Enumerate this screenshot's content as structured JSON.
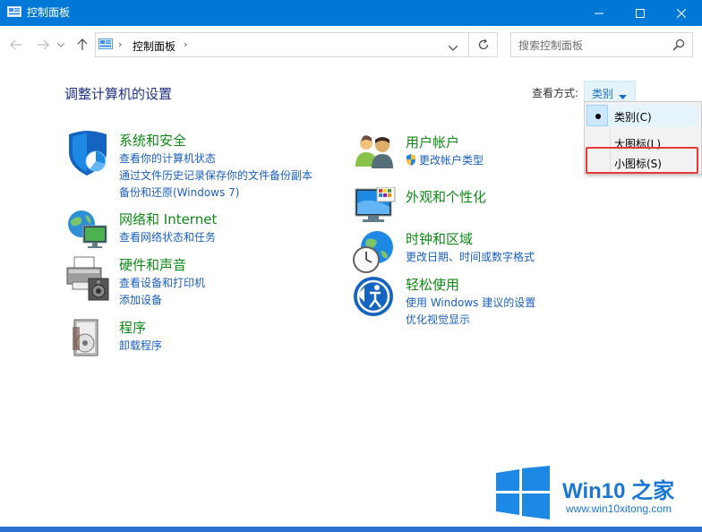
{
  "window": {
    "title": "控制面板"
  },
  "address": {
    "breadcrumb": "控制面板",
    "search_placeholder": "搜索控制面板"
  },
  "main": {
    "heading": "调整计算机的设置",
    "view_by_label": "查看方式:",
    "view_by_value": "类别"
  },
  "view_menu": {
    "items": [
      "类别(C)",
      "大图标(L)",
      "小图标(S)"
    ],
    "selected": "类别(C)",
    "highlighted": "小图标(S)"
  },
  "categories": {
    "left": [
      {
        "title": "系统和安全",
        "links": [
          "查看你的计算机状态",
          "通过文件历史记录保存你的文件备份副本",
          "备份和还原(Windows 7)"
        ]
      },
      {
        "title": "网络和 Internet",
        "links": [
          "查看网络状态和任务"
        ]
      },
      {
        "title": "硬件和声音",
        "links": [
          "查看设备和打印机",
          "添加设备"
        ]
      },
      {
        "title": "程序",
        "links": [
          "卸载程序"
        ]
      }
    ],
    "right": [
      {
        "title": "用户帐户",
        "links": [
          "更改帐户类型"
        ]
      },
      {
        "title": "外观和个性化",
        "links": []
      },
      {
        "title": "时钟和区域",
        "links": [
          "更改日期、时间或数字格式"
        ]
      },
      {
        "title": "轻松使用",
        "links": [
          "使用 Windows 建议的设置",
          "优化视觉显示"
        ]
      }
    ]
  },
  "watermark": {
    "brand": "Win10 之家",
    "url": "www.win10xitong.com"
  },
  "colors": {
    "titlebar": "#0078d7",
    "category_title": "#0e8a16",
    "link": "#1a5fbd",
    "highlight": "#e53935"
  }
}
